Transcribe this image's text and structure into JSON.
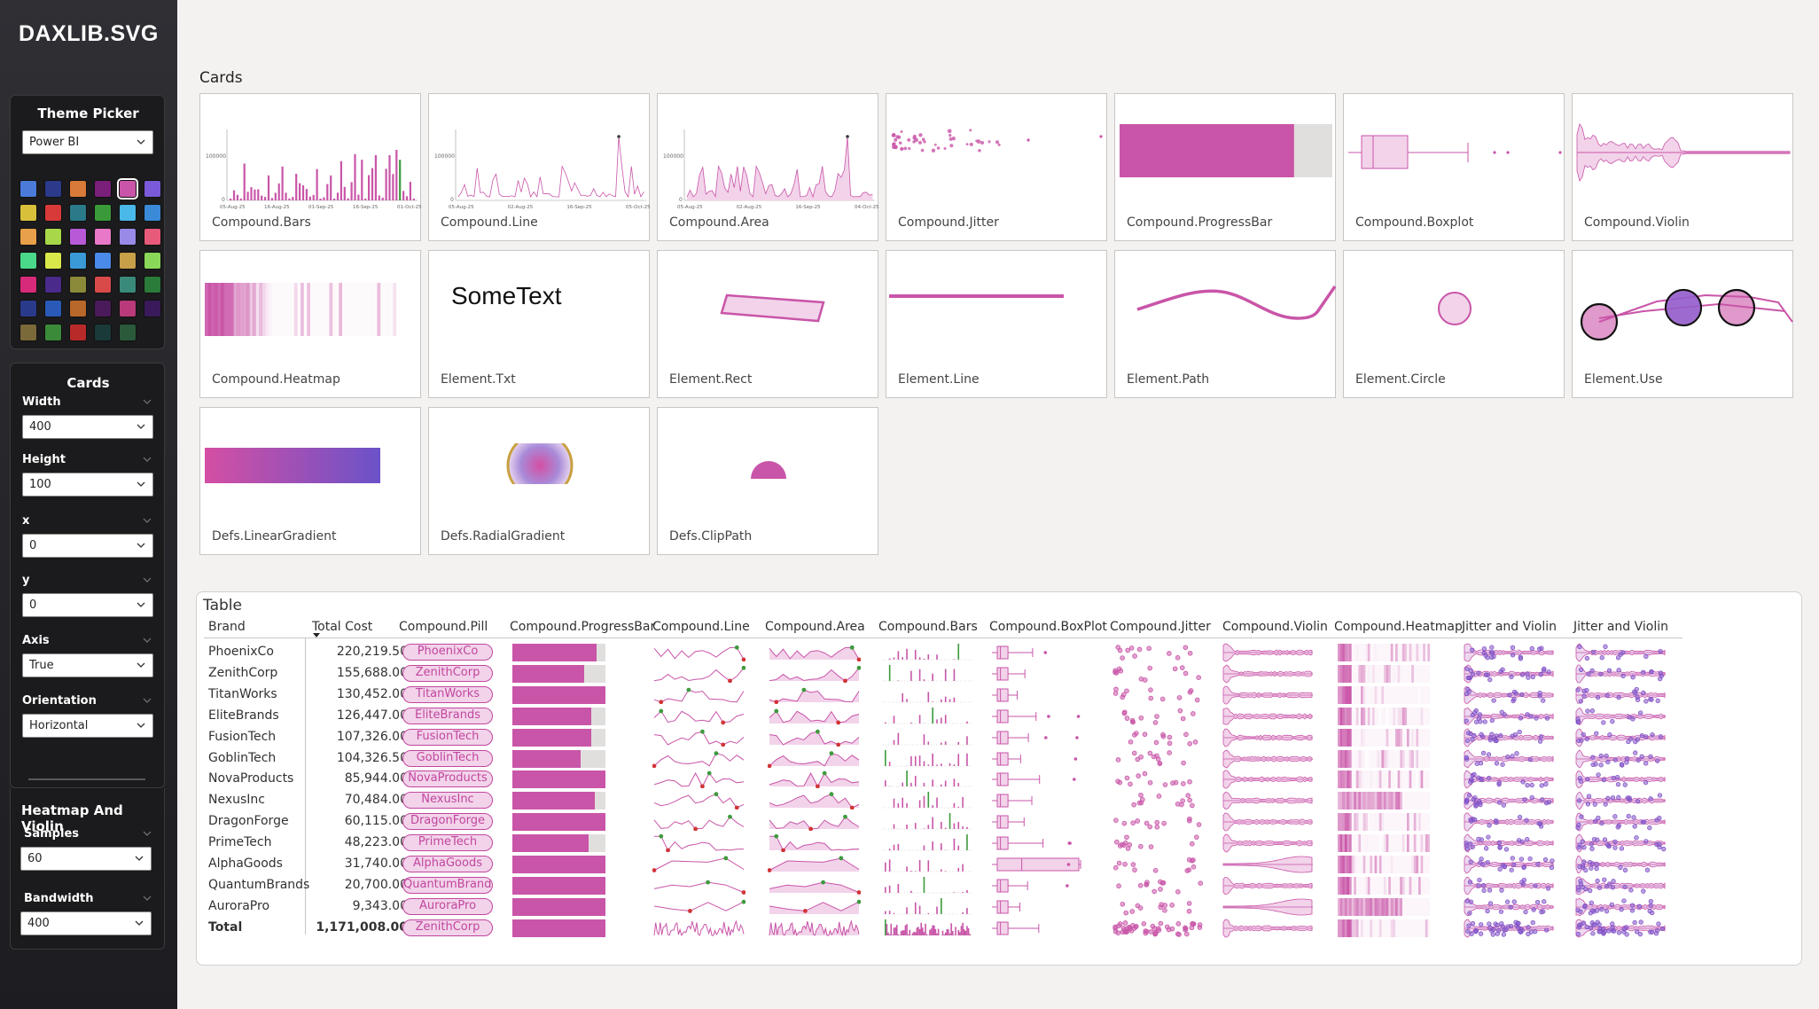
{
  "app": {
    "title": "DAXLIB.SVG"
  },
  "colors": {
    "accent": "#c955a8",
    "accent_light": "#f2d3ea",
    "purple": "#8c5fd0",
    "green": "#3d9a3d",
    "red": "#d13438"
  },
  "theme_picker": {
    "title": "Theme Picker",
    "selected": "Power BI",
    "swatches": [
      "#4a7bd8",
      "#2c3a8c",
      "#d87a3a",
      "#7a1f7a",
      "#c955a8",
      "#7a5ad8",
      "#d8c03a",
      "#d83a3a",
      "#2a7a8a",
      "#3a9a3a",
      "#4ab8e8",
      "#3a8ad8",
      "#e8a04a",
      "#a8d84a",
      "#b85ad8",
      "#e878c8",
      "#9a8ae8",
      "#e85a7a",
      "#4ad88a",
      "#d8e84a",
      "#3a9ad8",
      "#4a8ae8",
      "#c8a04a",
      "#8ad85a",
      "#d82a7a",
      "#4a2a8a",
      "#8a8a3a",
      "#d84a4a",
      "#3a8a7a",
      "#2a7a3a",
      "#2a3a8a",
      "#2a5ab8",
      "#b8682a",
      "#4a1a5a",
      "#b83a7a",
      "#3a1a5a",
      "#7a6a3a",
      "#3a8a3a",
      "#b82a2a",
      "#1a3a3a",
      "#2a5a3a"
    ],
    "selected_swatch": 4
  },
  "cards_panel": {
    "title": "Cards",
    "fields": [
      {
        "label": "Width",
        "value": "400"
      },
      {
        "label": "Height",
        "value": "100"
      },
      {
        "label": "x",
        "value": "0"
      },
      {
        "label": "y",
        "value": "0"
      },
      {
        "label": "Axis",
        "value": "True"
      },
      {
        "label": "Orientation",
        "value": "Horizontal"
      }
    ]
  },
  "heatmap_panel": {
    "title": "Heatmap And Violin",
    "fields": [
      {
        "label": "Samples",
        "value": "60"
      },
      {
        "label": "Bandwidth",
        "value": "400"
      }
    ]
  },
  "cards_section": {
    "title": "Cards",
    "cards": [
      {
        "label": "Compound.Bars",
        "axis_max": "100000",
        "dates": [
          "05-Aug-25",
          "16-Aug-25",
          "01-Sep-25",
          "16-Sep-25",
          "01-Oct-25"
        ]
      },
      {
        "label": "Compound.Line",
        "axis_max": "100000",
        "dates": [
          "05-Aug-25",
          "02-Aug-25",
          "16-Sep-25",
          "05-Oct-25"
        ]
      },
      {
        "label": "Compound.Area",
        "axis_max": "100000",
        "dates": [
          "05-Aug-25",
          "02-Aug-25",
          "16-Sep-25",
          "04-Oct-25"
        ]
      },
      {
        "label": "Compound.Jitter"
      },
      {
        "label": "Compound.ProgressBar",
        "progress": 0.82
      },
      {
        "label": "Compound.Boxplot"
      },
      {
        "label": "Compound.Violin"
      },
      {
        "label": "Compound.Heatmap"
      },
      {
        "label": "Element.Txt",
        "text": "SomeText"
      },
      {
        "label": "Element.Rect"
      },
      {
        "label": "Element.Line"
      },
      {
        "label": "Element.Path"
      },
      {
        "label": "Element.Circle"
      },
      {
        "label": "Element.Use"
      },
      {
        "label": "Defs.LinearGradient"
      },
      {
        "label": "Defs.RadialGradient"
      },
      {
        "label": "Defs.ClipPath"
      }
    ]
  },
  "table": {
    "title": "Table",
    "columns": [
      "Brand",
      "Total Cost",
      "Compound.Pill",
      "Compound.ProgressBar",
      "Compound.Line",
      "Compound.Area",
      "Compound.Bars",
      "Compound.BoxPlot",
      "Compound.Jitter",
      "Compound.Violin",
      "Compound.Heatmap",
      "Jitter and Violin",
      "Jitter and Violin"
    ],
    "rows": [
      {
        "brand": "PhoenixCo",
        "cost": "220,219.50",
        "pill": "PhoenixCo",
        "progress": 0.9
      },
      {
        "brand": "ZenithCorp",
        "cost": "155,688.00",
        "pill": "ZenithCorp",
        "progress": 0.77
      },
      {
        "brand": "TitanWorks",
        "cost": "130,452.00",
        "pill": "TitanWorks",
        "progress": 1.0
      },
      {
        "brand": "EliteBrands",
        "cost": "126,447.00",
        "pill": "EliteBrands",
        "progress": 0.85
      },
      {
        "brand": "FusionTech",
        "cost": "107,326.00",
        "pill": "FusionTech",
        "progress": 0.85
      },
      {
        "brand": "GoblinTech",
        "cost": "104,326.50",
        "pill": "GoblinTech",
        "progress": 0.73
      },
      {
        "brand": "NovaProducts",
        "cost": "85,944.00",
        "pill": "NovaProducts",
        "progress": 1.0
      },
      {
        "brand": "NexusInc",
        "cost": "70,484.00",
        "pill": "NexusInc",
        "progress": 0.89
      },
      {
        "brand": "DragonForge",
        "cost": "60,115.00",
        "pill": "DragonForge",
        "progress": 1.0
      },
      {
        "brand": "PrimeTech",
        "cost": "48,223.00",
        "pill": "PrimeTech",
        "progress": 0.82
      },
      {
        "brand": "AlphaGoods",
        "cost": "31,740.00",
        "pill": "AlphaGoods",
        "progress": 1.0
      },
      {
        "brand": "QuantumBrands",
        "cost": "20,700.00",
        "pill": "QuantumBrands",
        "progress": 1.0
      },
      {
        "brand": "AuroraPro",
        "cost": "9,343.00",
        "pill": "AuroraPro",
        "progress": 1.0
      }
    ],
    "total": {
      "brand": "Total",
      "cost": "1,171,008.00",
      "pill": "ZenithCorp",
      "progress": 1.0
    }
  }
}
